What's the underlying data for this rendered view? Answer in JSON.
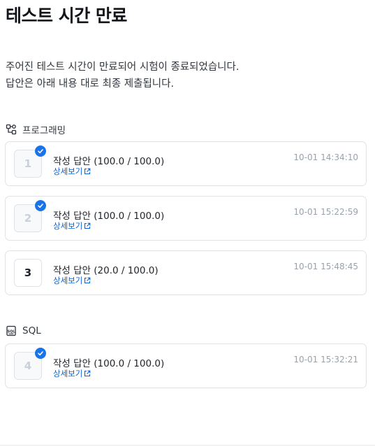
{
  "page": {
    "title": "테스트 시간 만료",
    "message_line1": "주어진 테스트 시간이 만료되어 시험이 종료되었습니다.",
    "message_line2": "답안은 아래 내용 대로 최종 제출됩니다."
  },
  "sections": [
    {
      "label": "프로그래밍",
      "icon": "programming-icon",
      "items": [
        {
          "number": "1",
          "answer": "작성 답안 (100.0 / 100.0)",
          "link": "상세보기",
          "time": "10-01 14:34:10",
          "completed": true
        },
        {
          "number": "2",
          "answer": "작성 답안 (100.0 / 100.0)",
          "link": "상세보기",
          "time": "10-01 15:22:59",
          "completed": true
        },
        {
          "number": "3",
          "answer": "작성 답안 (20.0 / 100.0)",
          "link": "상세보기",
          "time": "10-01 15:48:45",
          "completed": false
        }
      ]
    },
    {
      "label": "SQL",
      "icon": "sql-icon",
      "items": [
        {
          "number": "4",
          "answer": "작성 답안 (100.0 / 100.0)",
          "link": "상세보기",
          "time": "10-01 15:32:21",
          "completed": true
        }
      ]
    }
  ],
  "colors": {
    "accent": "#1a73e8",
    "link": "#0b63d6",
    "timestamp": "#98a2ad",
    "border": "#dfe3e8"
  }
}
